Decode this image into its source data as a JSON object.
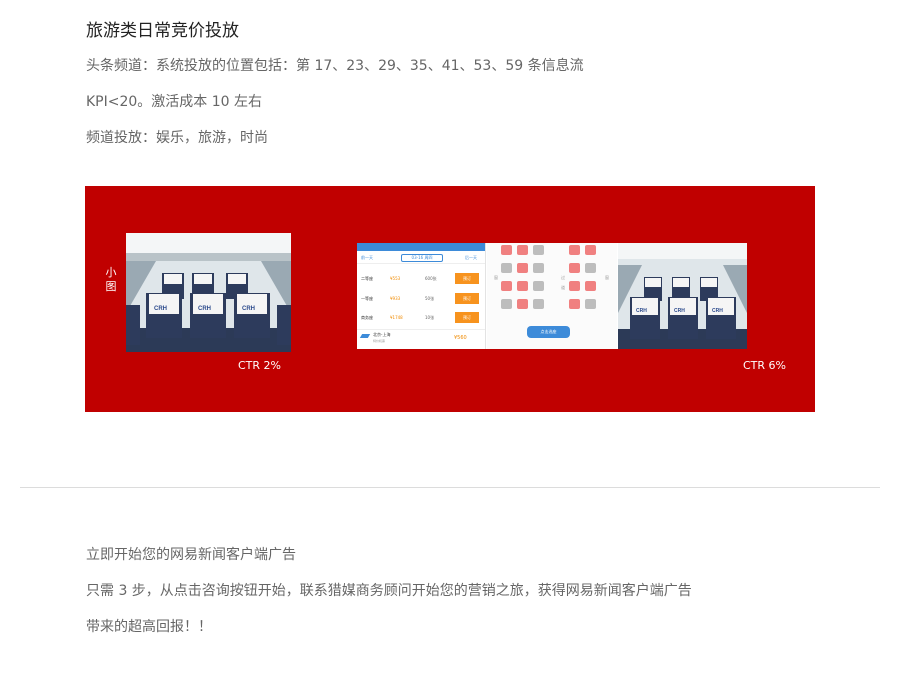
{
  "section": {
    "title": "旅游类日常竞价投放",
    "lines": [
      "头条频道：系统投放的位置包括：第 17、23、29、35、41、53、59 条信息流",
      "KPI<20。激活成本 10 左右",
      " 频道投放：娱乐，旅游，时尚"
    ]
  },
  "banner": {
    "background_color": "#c00000",
    "small_image_label": "小图",
    "ctr_left": "CTR 2%",
    "ctr_right": "CTR 6%",
    "mock": {
      "prev_day": "前一天",
      "date": "03-16 周四",
      "next_day": "后一天",
      "seat_rows": [
        {
          "class": "二等座",
          "price": "¥553",
          "left": "600张",
          "button": "预订"
        },
        {
          "class": "一等座",
          "price": "¥933",
          "left": "50张",
          "button": "预订"
        },
        {
          "class": "商务座",
          "price": "¥1748",
          "left": "10张",
          "button": "预订"
        }
      ],
      "flight_route": "北京-上海",
      "flight_note": "特价机票",
      "flight_price": "¥560",
      "seat_map_labels": [
        "窗",
        "过",
        "道",
        "窗"
      ],
      "select_button": "点击选座",
      "crh_text": "CRH",
      "headrest_text": "和谐号"
    }
  },
  "cta": {
    "heading": "立即开始您的网易新闻客户端广告",
    "line1": "只需 3 步，从点击咨询按钮开始，联系猎媒商务顾问开始您的营销之旅，获得网易新闻客户端广告",
    "line2": "带来的超高回报！！"
  }
}
